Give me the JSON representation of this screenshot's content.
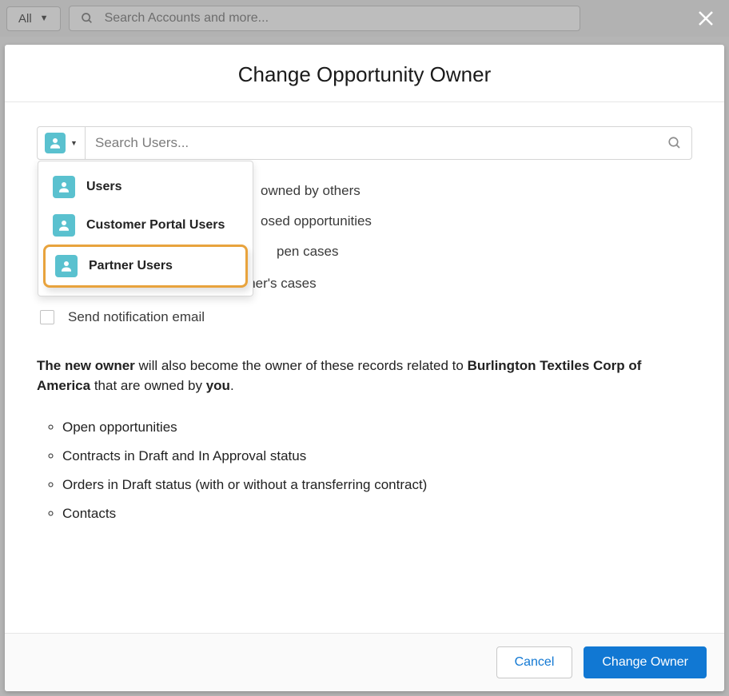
{
  "bg": {
    "filter_label": "All",
    "search_placeholder": "Search Accounts and more..."
  },
  "modal": {
    "title": "Change Opportunity Owner",
    "lookup_placeholder": "Search Users...",
    "dropdown": {
      "items": [
        {
          "label": "Users"
        },
        {
          "label": "Customer Portal Users"
        },
        {
          "label": "Partner Users"
        }
      ],
      "highlight_index": 2
    },
    "checks": [
      {
        "label_suffix": "owned by others"
      },
      {
        "label_suffix": "osed opportunities"
      },
      {
        "label_suffix": "pen cases"
      },
      {
        "label": "Transfer all of this account owner's cases"
      },
      {
        "label": "Send notification email"
      }
    ],
    "info": {
      "lead": "The new owner",
      "mid": " will also become the owner of these records related to ",
      "company": "Burlington Textiles Corp of America",
      "tail1": " that are owned by ",
      "you": "you",
      "tail2": "."
    },
    "records": [
      "Open opportunities",
      "Contracts in Draft and In Approval status",
      "Orders in Draft status (with or without a transferring contract)",
      "Contacts"
    ],
    "buttons": {
      "cancel": "Cancel",
      "primary": "Change Owner"
    }
  }
}
